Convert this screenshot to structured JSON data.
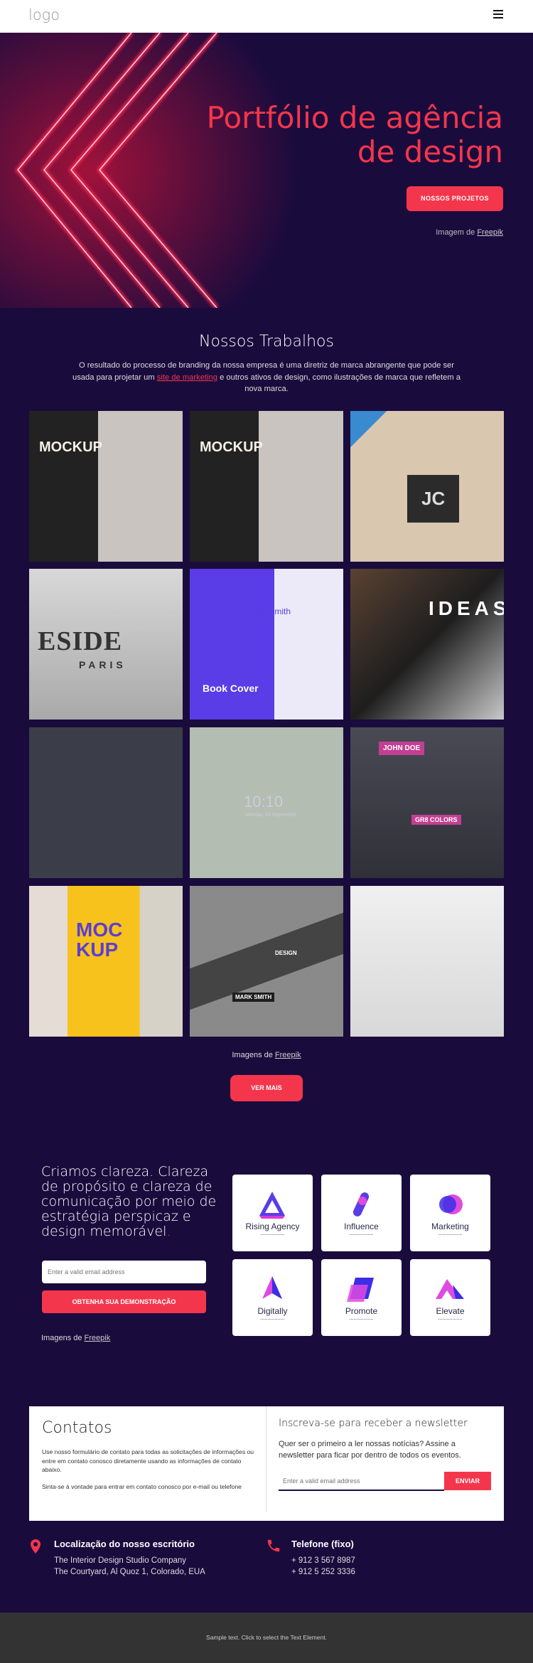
{
  "header": {
    "logo": "logo",
    "menu_icon": "hamburger-icon"
  },
  "hero": {
    "title": "Portfólio de agência de design",
    "button": "NOSSOS PROJETOS",
    "credit_prefix": "Imagem de ",
    "credit_link": "Freepik"
  },
  "works": {
    "title": "Nossos Trabalhos",
    "desc_before": "O resultado do processo de branding da nossa empresa é uma diretriz de marca abrangente que pode ser usada para projetar um ",
    "desc_link": "site de marketing",
    "desc_after": " e outros ativos de design, como ilustrações de marca que refletem a nova marca.",
    "gallery": [
      {
        "text": "MOCKUP"
      },
      {
        "text": "MOCKUP"
      },
      {
        "text": "JC"
      },
      {
        "text": "ESIDE",
        "sub": "PARIS"
      },
      {
        "text": "Book Cover",
        "sub": "John Smith"
      },
      {
        "text": "IDEAS"
      },
      {
        "text": ""
      },
      {
        "text": "10:10",
        "sub": "Monday, 01 September"
      },
      {
        "text": "JOHN DOE",
        "sub": "GR8 COLORS"
      },
      {
        "text": "MOC KUP"
      },
      {
        "text": "DESIGN",
        "sub": "MARK SMITH"
      },
      {
        "text": ""
      }
    ],
    "credit_prefix": "Imagens de ",
    "credit_link": "Freepik",
    "more_button": "VER MAIS"
  },
  "clarity": {
    "text": "Criamos clareza. Clareza de propósito e clareza de comunicação por meio de estratégia perspicaz e design memorável",
    "dot": ".",
    "email_placeholder": "Enter a valid email address",
    "button": "OBTENHA SUA DEMONSTRAÇÃO",
    "credit_prefix": "Imagens de ",
    "credit_link": "Freepik",
    "logos": [
      {
        "name": "Rising Agency"
      },
      {
        "name": "Influence"
      },
      {
        "name": "Marketing"
      },
      {
        "name": "Digitally"
      },
      {
        "name": "Promote"
      },
      {
        "name": "Elevate"
      }
    ]
  },
  "contact": {
    "title": "Contatos",
    "p1": "Use nosso formulário de contato para todas as solicitações de informações ou entre em contato conosco diretamente usando as informações de contato abaixo.",
    "p2": "Sinta-se à vontade para entrar em contato conosco por e-mail ou telefone",
    "newsletter_title": "Inscreva-se para receber a newsletter",
    "newsletter_desc": "Quer ser o primeiro a ler nossas notícias? Assine a newsletter para ficar por dentro de todos os eventos.",
    "email_placeholder": "Enter a valid email address",
    "send": "ENVIAR"
  },
  "info": {
    "location": {
      "title": "Localização do nosso escritório",
      "line1": "The Interior Design Studio Company",
      "line2": "The Courtyard, Al Quoz 1, Colorado,  EUA"
    },
    "phone": {
      "title": "Telefone (fixo)",
      "line1": "+ 912 3 567 8987",
      "line2": "+ 912 5 252 3336"
    }
  },
  "footer": {
    "text": "Sample text. Click to select the Text Element."
  },
  "colors": {
    "background": "#1a0b3d",
    "accent": "#f4364c",
    "footer": "#333333"
  }
}
